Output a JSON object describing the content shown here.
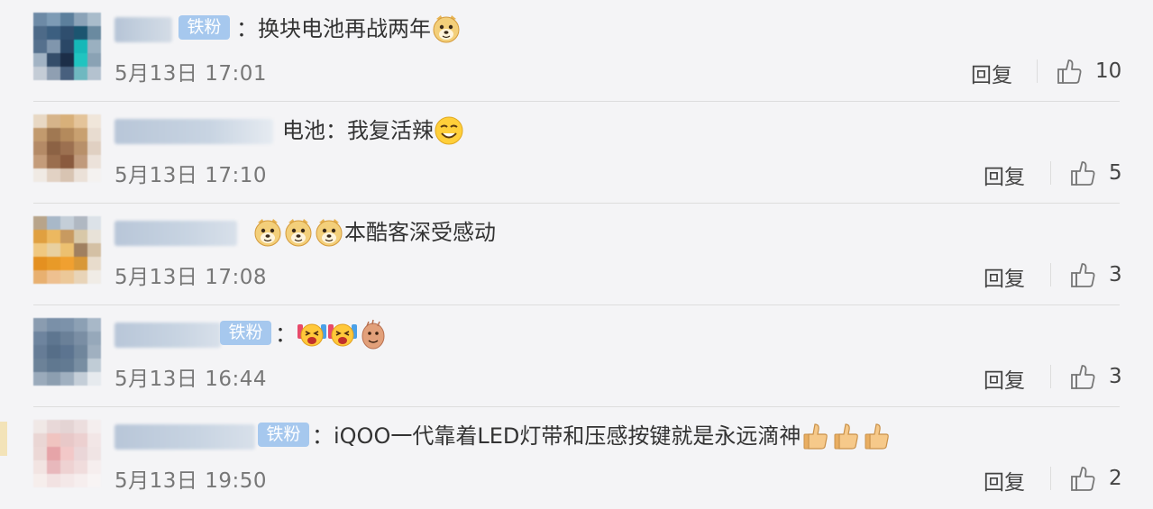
{
  "comments": [
    {
      "badge": "铁粉",
      "text": "：换块电池再战两年",
      "emojis": [
        "doge-emoji"
      ],
      "time": "5月13日 17:01",
      "reply": "回复",
      "likes": "10"
    },
    {
      "badge": "",
      "text": "电池：我复活辣",
      "emojis": [
        "smirk-emoji"
      ],
      "time": "5月13日 17:10",
      "reply": "回复",
      "likes": "5"
    },
    {
      "badge": "",
      "text": "本酷客深受感动",
      "emojis": [
        "doge-emoji",
        "doge-emoji",
        "doge-emoji"
      ],
      "time": "5月13日 17:08",
      "reply": "回复",
      "likes": "3"
    },
    {
      "badge": "铁粉",
      "text": "：",
      "emojis": [
        "cheer-emoji",
        "cheer-emoji",
        "clap-emoji"
      ],
      "time": "5月13日 16:44",
      "reply": "回复",
      "likes": "3"
    },
    {
      "badge": "铁粉",
      "text": "：iQOO一代靠着LED灯带和压感按键就是永远滴神",
      "emojis": [
        "thumbs-up-emoji",
        "thumbs-up-emoji",
        "thumbs-up-emoji"
      ],
      "time": "5月13日 19:50",
      "reply": "回复",
      "likes": "2"
    }
  ],
  "colors": {
    "background": "#f4f4f6",
    "badge": "#a6c8ee",
    "meta_text": "#777777"
  }
}
